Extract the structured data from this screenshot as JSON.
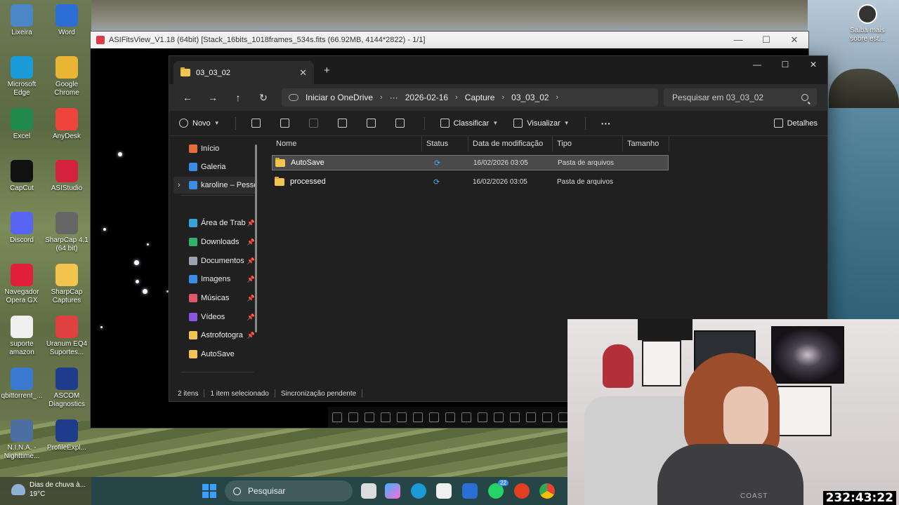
{
  "desktop": {
    "icons": [
      {
        "label": "Lixeira",
        "icon": "recycle-bin-icon",
        "color": "#4a86c8"
      },
      {
        "label": "Word",
        "icon": "word-icon",
        "color": "#2b6fd6"
      },
      {
        "label": "Microsoft Edge",
        "icon": "edge-icon",
        "color": "#1a9bd8"
      },
      {
        "label": "Google Chrome",
        "icon": "chrome-icon",
        "color": "#e8b632"
      },
      {
        "label": "Excel",
        "icon": "excel-icon",
        "color": "#1f8a4c"
      },
      {
        "label": "AnyDesk",
        "icon": "anydesk-icon",
        "color": "#ef443b"
      },
      {
        "label": "CapCut",
        "icon": "capcut-icon",
        "color": "#111111"
      },
      {
        "label": "ASIStudio",
        "icon": "asistudio-icon",
        "color": "#d4213d"
      },
      {
        "label": "Discord",
        "icon": "discord-icon",
        "color": "#5865f2"
      },
      {
        "label": "SharpCap 4.1 (64 bit)",
        "icon": "sharpcap-icon",
        "color": "#666666"
      },
      {
        "label": "Navegador Opera GX",
        "icon": "opera-gx-icon",
        "color": "#e0203b"
      },
      {
        "label": "SharpCap Captures",
        "icon": "folder-icon",
        "color": "#f3c44f"
      },
      {
        "label": "suporte amazon",
        "icon": "document-icon",
        "color": "#f0f0f0"
      },
      {
        "label": "Uranum EQ4 Suportes...",
        "icon": "pdf-icon",
        "color": "#e04040"
      },
      {
        "label": "qbittorrent_...",
        "icon": "qbittorrent-icon",
        "color": "#3a7ad0"
      },
      {
        "label": "ASCOM Diagnostics",
        "icon": "ascom-icon",
        "color": "#1e3c8c"
      },
      {
        "label": "N.I.N.A. - Nighttime...",
        "icon": "nina-icon",
        "color": "#4a6fa0"
      },
      {
        "label": "ProfileExpl...",
        "icon": "profile-explorer-icon",
        "color": "#1e3c8c"
      }
    ],
    "right_widget": "Saiba mais sobre est..."
  },
  "asi_window": {
    "title": "ASIFitsView_V1.18 (64bit) [Stack_16bits_1018frames_534s.fits (66.92MB, 4144*2822) - 1/1]"
  },
  "explorer": {
    "tab_title": "03_03_02",
    "nav": {
      "breadcrumb": [
        "Iniciar o OneDrive",
        "···",
        "2026-02-16",
        "Capture",
        "03_03_02"
      ],
      "search_placeholder": "Pesquisar em 03_03_02"
    },
    "commands": {
      "new": "Novo",
      "sort": "Classificar",
      "view": "Visualizar",
      "more": "···",
      "details": "Detalhes"
    },
    "sidebar": [
      {
        "label": "Início",
        "icon": "home-icon",
        "color": "#e86b3a",
        "pinned": false
      },
      {
        "label": "Galeria",
        "icon": "gallery-icon",
        "color": "#3a8de6",
        "pinned": false
      },
      {
        "label": "karoline – Pesso",
        "icon": "onedrive-icon",
        "color": "#3a8de6",
        "pinned": false
      },
      {
        "label": "Área de Trab",
        "icon": "desktop-icon",
        "color": "#36a3d8",
        "pinned": true
      },
      {
        "label": "Downloads",
        "icon": "download-icon",
        "color": "#2fb36a",
        "pinned": true
      },
      {
        "label": "Documentos",
        "icon": "documents-icon",
        "color": "#9aa4b0",
        "pinned": true
      },
      {
        "label": "Imagens",
        "icon": "pictures-icon",
        "color": "#3a8de6",
        "pinned": true
      },
      {
        "label": "Músicas",
        "icon": "music-icon",
        "color": "#e0566e",
        "pinned": true
      },
      {
        "label": "Vídeos",
        "icon": "videos-icon",
        "color": "#8a54e0",
        "pinned": true
      },
      {
        "label": "Astrofotogra",
        "icon": "folder-icon",
        "color": "#f3c44f",
        "pinned": true
      },
      {
        "label": "AutoSave",
        "icon": "folder-icon",
        "color": "#f3c44f",
        "pinned": false
      }
    ],
    "columns": [
      "Nome",
      "Status",
      "Data de modificação",
      "Tipo",
      "Tamanho"
    ],
    "rows": [
      {
        "name": "AutoSave",
        "status": "⟳",
        "date": "16/02/2026 03:05",
        "type": "Pasta de arquivos",
        "size": ""
      },
      {
        "name": "processed",
        "status": "⟳",
        "date": "16/02/2026 03:05",
        "type": "Pasta de arquivos",
        "size": ""
      }
    ],
    "status_bar": {
      "count": "2 itens",
      "selected": "1 item selecionado",
      "sync": "Sincronização pendente"
    }
  },
  "webcam": {
    "shirt_text": "COAST",
    "timer": "232:43:22"
  },
  "taskbar": {
    "weather_line1": "Dias de chuva à...",
    "weather_line2": "19°C",
    "search_label": "Pesquisar",
    "whatsapp_badge": "22"
  }
}
